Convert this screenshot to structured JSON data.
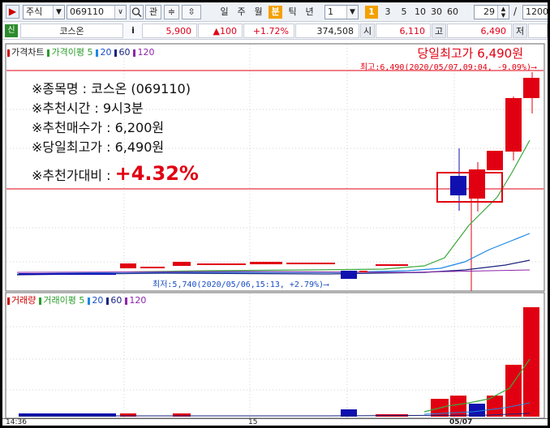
{
  "toolbar": {
    "icon_label": "▶",
    "market_type": "주식",
    "stock_code": "069110",
    "search_label": "관",
    "tabs": [
      "일",
      "주",
      "월",
      "분",
      "틱",
      "년"
    ],
    "active_tab": "분",
    "interval_value": "1",
    "periods": [
      "1",
      "3",
      "5",
      "10",
      "30",
      "60"
    ],
    "active_period": "1",
    "count_value": "29",
    "slash": "/",
    "total_value": "1200"
  },
  "quote": {
    "badge": "신",
    "name": "코스온",
    "info_icon": "i",
    "price": "5,900",
    "change": "▲100",
    "change_pct": "+1.72%",
    "volume": "374,508",
    "open_label": "시",
    "open": "6,110",
    "high_label": "고",
    "high": "6,490",
    "low_label": "저"
  },
  "price_pane": {
    "legend": [
      {
        "label": "가격차트",
        "color": "#d00000"
      },
      {
        "label": "가격이평",
        "color": "#2a9d2a"
      },
      {
        "label": "5",
        "color": "#2a9d2a"
      },
      {
        "label": "20",
        "color": "#1e88e5"
      },
      {
        "label": "60",
        "color": "#1a237e"
      },
      {
        "label": "120",
        "color": "#8e24aa"
      }
    ],
    "headline": "당일최고가 6,490원",
    "high_note": "최고:6,490(2020/05/07,09:04, -9.09%)⟶",
    "low_note": "최저:5,740(2020/05/06,15:13, +2.79%)⟶",
    "info_lines": [
      "※종목명 : 코스온 (069110)",
      "※추천시간 : 9시3분",
      "※추천매수가 : 6,200원",
      "※당일최고가 : 6,490원"
    ],
    "ratio_label": "※추천가대비 : ",
    "ratio_value": "+4.32%"
  },
  "volume_pane": {
    "legend": [
      {
        "label": "거래량",
        "color": "#d00000"
      },
      {
        "label": "거래이평",
        "color": "#2a9d2a"
      },
      {
        "label": "5",
        "color": "#2a9d2a"
      },
      {
        "label": "20",
        "color": "#1e88e5"
      },
      {
        "label": "60",
        "color": "#1a237e"
      },
      {
        "label": "120",
        "color": "#8e24aa"
      }
    ]
  },
  "x_axis": {
    "labels": [
      "14:36",
      "15",
      "05/07"
    ]
  },
  "colors": {
    "up": "#e10012",
    "down": "#1010b0",
    "accent": "#f4a000"
  }
}
